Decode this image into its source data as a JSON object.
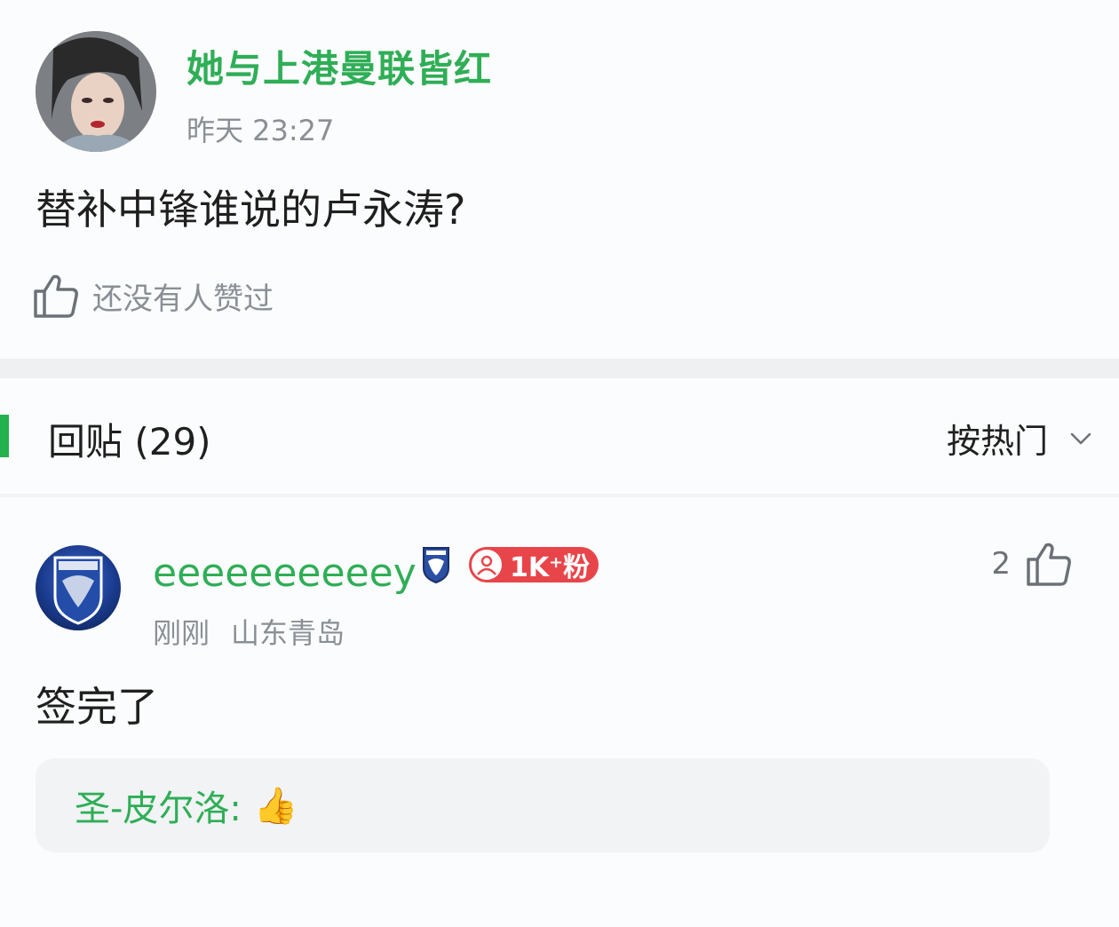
{
  "post": {
    "author": "她与上港曼联皆红",
    "time": "昨天 23:27",
    "body": "替补中锋谁说的卢永涛?",
    "like_text": "还没有人赞过"
  },
  "replies_header": {
    "title": "回贴 (29)",
    "sort_label": "按热门"
  },
  "comment": {
    "author": "eeeeeeeeeey",
    "fans_badge": "1K⁺粉",
    "time": "刚刚",
    "location": "山东青岛",
    "like_count": "2",
    "body": "签完了",
    "sub_reply": {
      "author": "圣-皮尔洛:",
      "emoji": "👍"
    }
  },
  "colors": {
    "accent_green": "#2fae56",
    "badge_red": "#e8454a"
  }
}
